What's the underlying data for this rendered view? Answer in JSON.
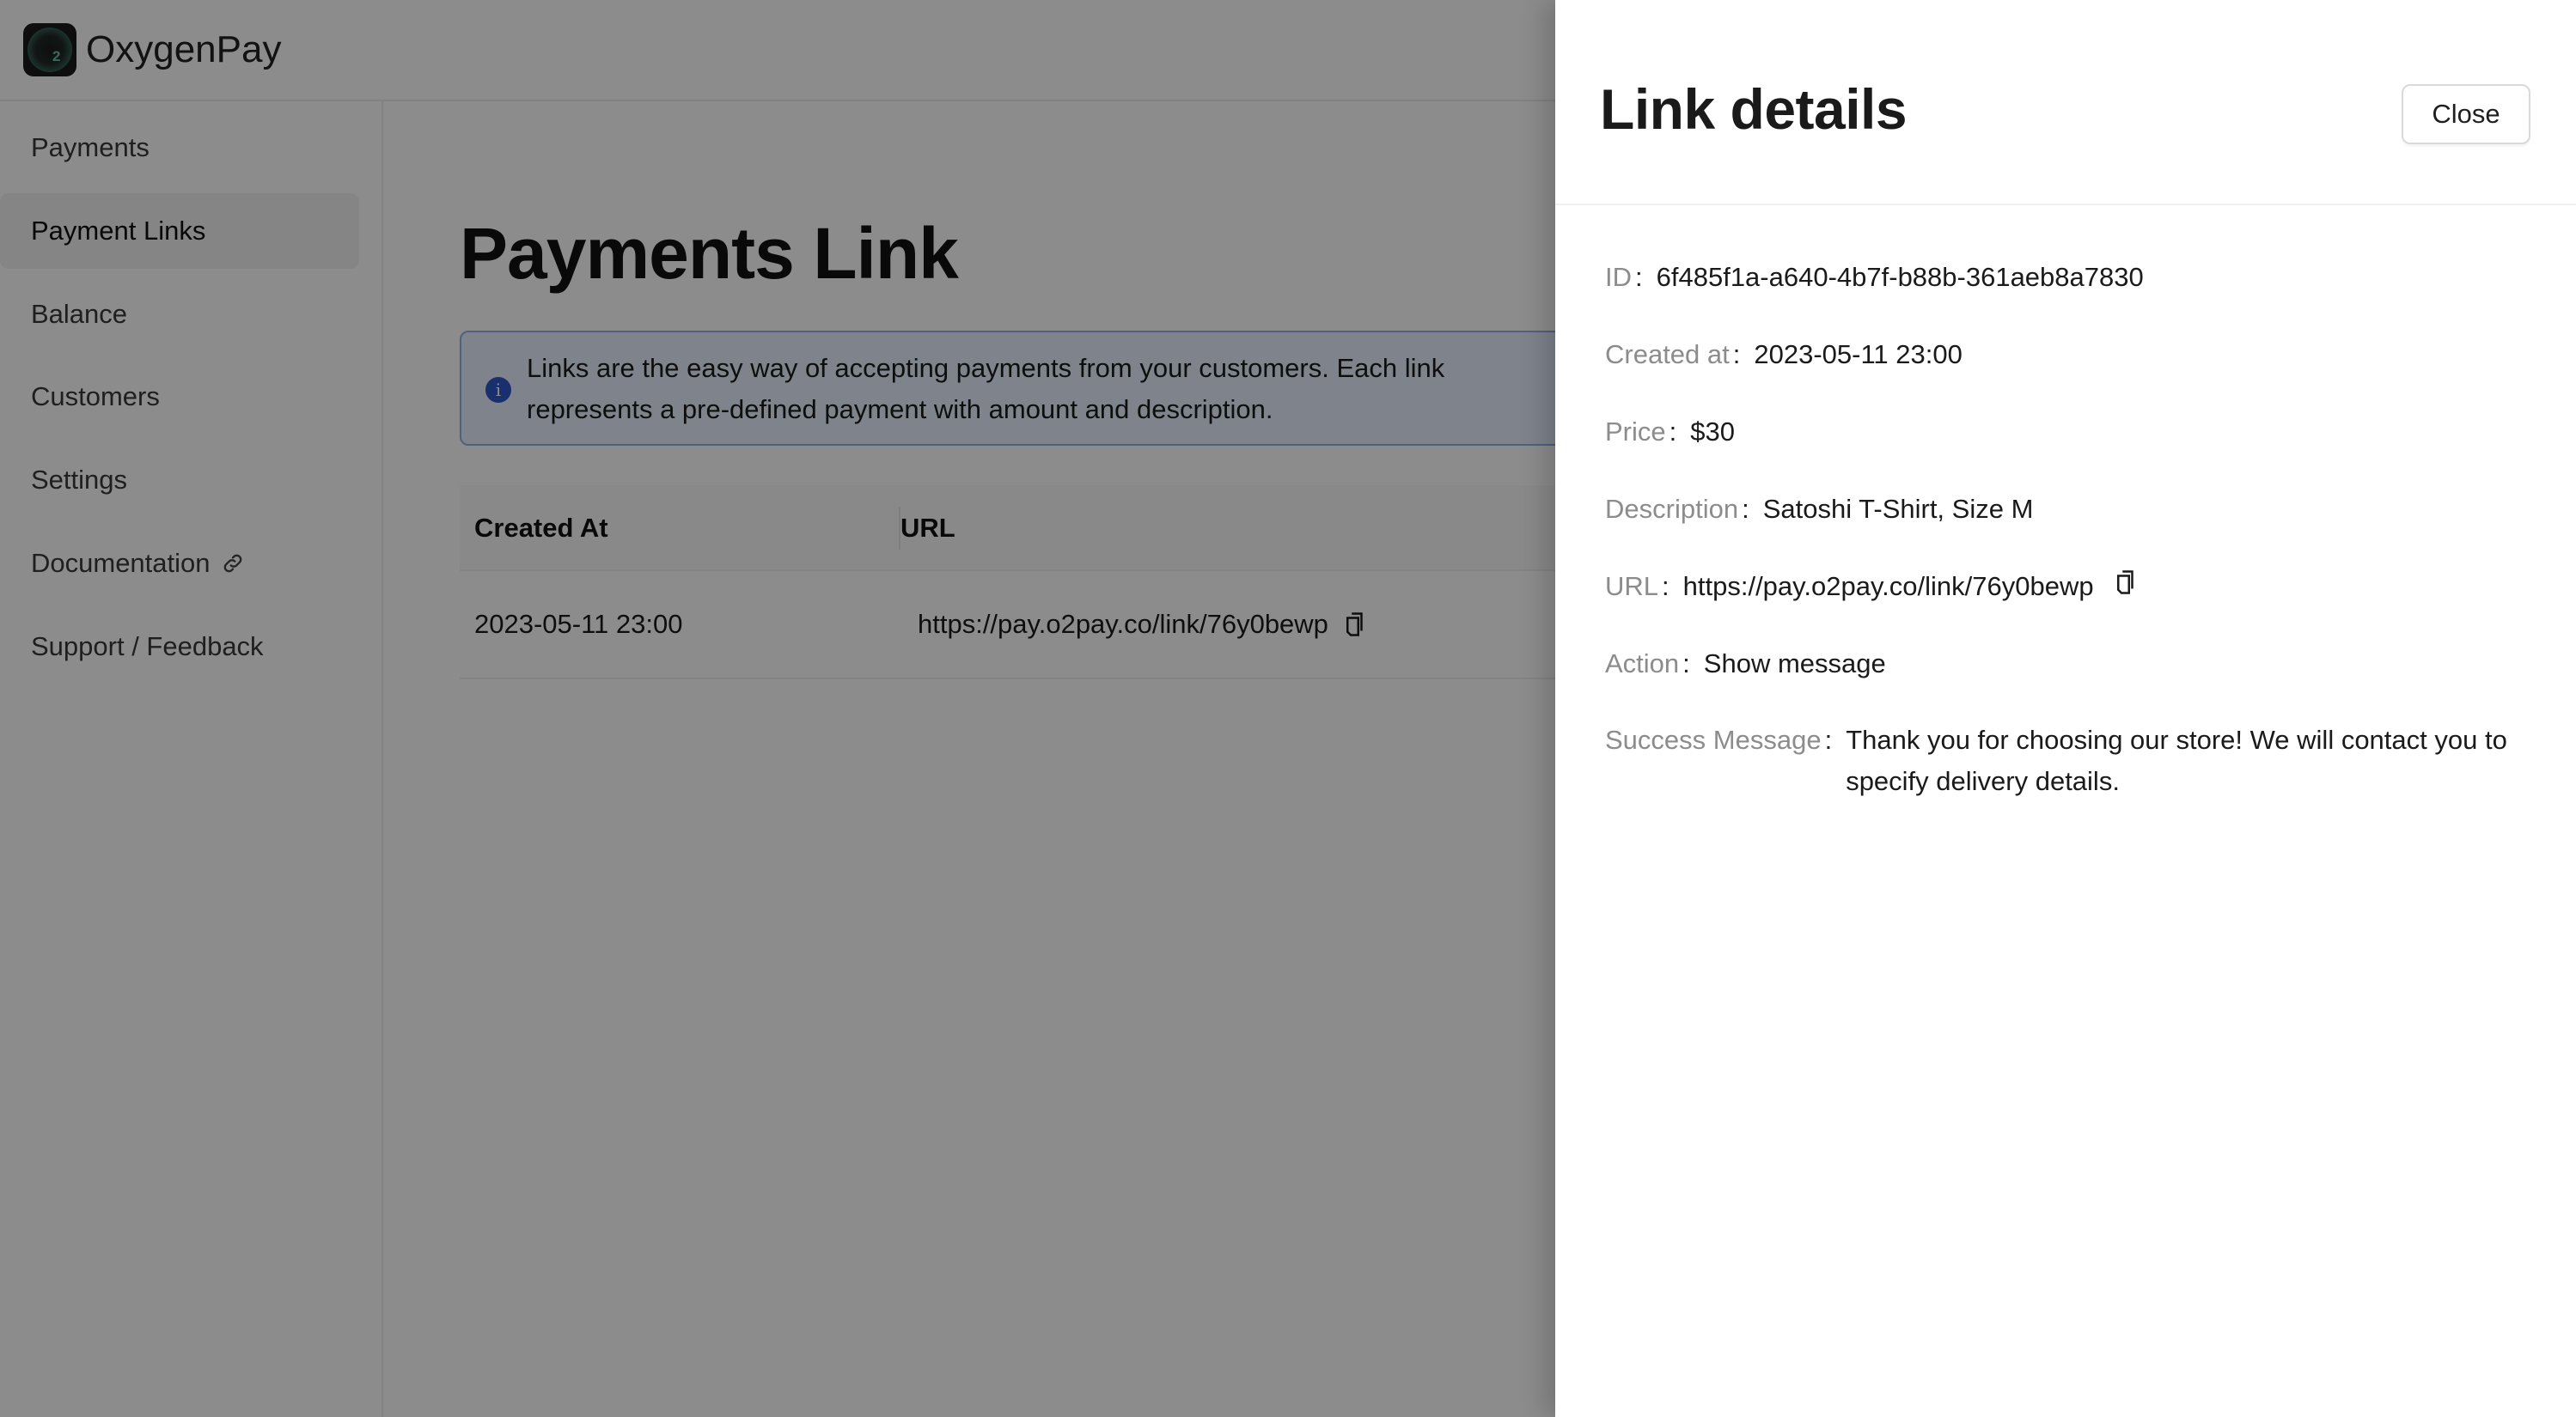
{
  "app": {
    "brand_name": "OxygenPay",
    "logo_mark": "2"
  },
  "sidebar": {
    "items": [
      {
        "label": "Payments",
        "active": false
      },
      {
        "label": "Payment Links",
        "active": true
      },
      {
        "label": "Balance",
        "active": false
      },
      {
        "label": "Customers",
        "active": false
      },
      {
        "label": "Settings",
        "active": false
      },
      {
        "label": "Documentation",
        "active": false,
        "icon": "link-icon"
      },
      {
        "label": "Support / Feedback",
        "active": false
      }
    ]
  },
  "main": {
    "title": "Payments Link",
    "info_alert": {
      "icon": "info-icon",
      "text": "Links are the easy way of accepting payments from your customers. Each link represents a pre-defined payment with amount and description."
    },
    "table": {
      "columns": [
        "Created At",
        "URL"
      ],
      "rows": [
        {
          "created_at": "2023-05-11 23:00",
          "url": "https://pay.o2pay.co/link/76y0bewp"
        }
      ]
    }
  },
  "drawer": {
    "title": "Link details",
    "close_label": "Close",
    "fields": [
      {
        "label": "ID",
        "value": "6f485f1a-a640-4b7f-b88b-361aeb8a7830"
      },
      {
        "label": "Created at",
        "value": "2023-05-11 23:00"
      },
      {
        "label": "Price",
        "value": "$30"
      },
      {
        "label": "Description",
        "value": "Satoshi T-Shirt, Size M"
      },
      {
        "label": "URL",
        "value": "https://pay.o2pay.co/link/76y0bewp"
      },
      {
        "label": "Action",
        "value": "Show message"
      },
      {
        "label": "Success Message",
        "value": "Thank you for choosing our store! We will contact you to specify delivery details."
      }
    ],
    "colon": ":"
  },
  "colors": {
    "info_accent": "#2f57c9",
    "info_background": "#e6efff",
    "label_gray": "#8c8c8c"
  }
}
